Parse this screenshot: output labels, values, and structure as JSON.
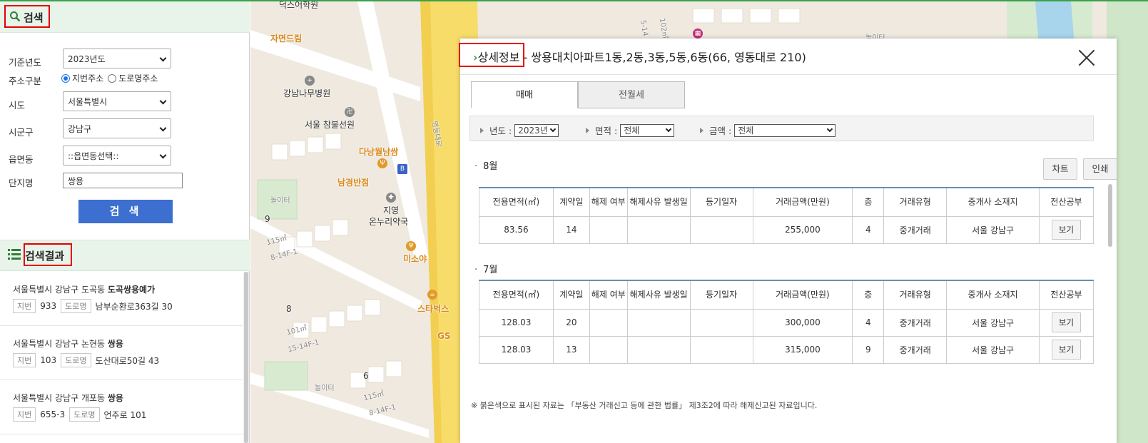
{
  "search_panel": {
    "title": "검색",
    "fields": {
      "year_label": "기준년도",
      "year_value": "2023년도",
      "addr_type_label": "주소구분",
      "addr_opt_jibun": "지번주소",
      "addr_opt_road": "도로명주소",
      "sido_label": "시도",
      "sido_value": "서울특별시",
      "sigungu_label": "시군구",
      "sigungu_value": "강남구",
      "eupmyeondong_label": "읍면동",
      "eupmyeondong_value": "::읍면동선택::",
      "complex_label": "단지명",
      "complex_value": "쌍용"
    },
    "search_button": "검 색"
  },
  "results_panel": {
    "title": "검색결과",
    "items": [
      {
        "addr_prefix": "서울특별시 강남구 도곡동 ",
        "name": "도곡쌍용예가",
        "jibun_tag": "지번",
        "jibun": "933",
        "road_tag": "도로명",
        "road": "남부순환로363길 30"
      },
      {
        "addr_prefix": "서울특별시 강남구 논현동 ",
        "name": "쌍용",
        "jibun_tag": "지번",
        "jibun": "103",
        "road_tag": "도로명",
        "road": "도산대로50길 43"
      },
      {
        "addr_prefix": "서울특별시 강남구 개포동 ",
        "name": "쌍용",
        "jibun_tag": "지번",
        "jibun": "655-3",
        "road_tag": "도로명",
        "road": "언주로 101"
      }
    ]
  },
  "map": {
    "labels": {
      "top_academy": "덕스어학원",
      "jamyeon": "자면드림",
      "hospital": "강남나무병원",
      "temple": "서울 참불선원",
      "dalnang": "다낭월남쌈",
      "namgyeong": "남경반점",
      "pharmacy_1": "지영",
      "pharmacy_2": "온누리약국",
      "misoya": "미소야",
      "starbucks": "스타벅스",
      "gs": "GS",
      "playground_1": "놀이터",
      "playground_2": "놀이터",
      "playground_3": "놀이터",
      "num_9": "9",
      "num_8": "8",
      "num_6": "6",
      "area_115_a": "115㎡",
      "area_115_b": "115㎡",
      "area_101": "101㎡",
      "code_814": "8-14F-1",
      "code_1514": "15-14F-1",
      "code_814_b": "8-14F-1",
      "road_vertical": "영동대로",
      "top_right_num": "102㎡",
      "top_right_code": "5-14"
    }
  },
  "detail_dialog": {
    "title_prefix": "상세정보",
    "title_rest": " - 쌍용대치아파트1동,2동,3동,5동,6동(66, 영동대로 210)",
    "tabs": [
      "매매",
      "전월세"
    ],
    "filters": {
      "year_label": "년도 :",
      "year_value": "2023년",
      "area_label": "면적 :",
      "area_value": "전체",
      "price_label": "금액 :",
      "price_value": "전체"
    },
    "chart_button": "차트",
    "print_button": "인쇄",
    "columns": [
      "전용면적(㎡)",
      "계약일",
      "해제 여부",
      "해제사유 발생일",
      "등기일자",
      "거래금액(만원)",
      "층",
      "거래유형",
      "중개사 소재지",
      "전산공부"
    ],
    "months": [
      {
        "label": "8월",
        "rows": [
          {
            "area": "83.56",
            "day": "14",
            "cancel": "",
            "cancel_date": "",
            "reg_date": "",
            "price": "255,000",
            "floor": "4",
            "type": "중개거래",
            "broker": "서울 강남구",
            "view": "보기"
          }
        ]
      },
      {
        "label": "7월",
        "rows": [
          {
            "area": "128.03",
            "day": "20",
            "cancel": "",
            "cancel_date": "",
            "reg_date": "",
            "price": "300,000",
            "floor": "4",
            "type": "중개거래",
            "broker": "서울 강남구",
            "view": "보기"
          },
          {
            "area": "128.03",
            "day": "13",
            "cancel": "",
            "cancel_date": "",
            "reg_date": "",
            "price": "315,000",
            "floor": "9",
            "type": "중개거래",
            "broker": "서울 강남구",
            "view": "보기"
          }
        ]
      }
    ],
    "footnote": "※ 붉은색으로 표시된 자료는 「부동산 거래신고 등에 관한 법률」 제3조2에 따라 해제신고된 자료입니다."
  },
  "colors": {
    "accent_green": "#3aa14a",
    "search_button": "#3c6fd0",
    "highlight_red": "#e60000",
    "header_bg": "#e8f3ea"
  }
}
